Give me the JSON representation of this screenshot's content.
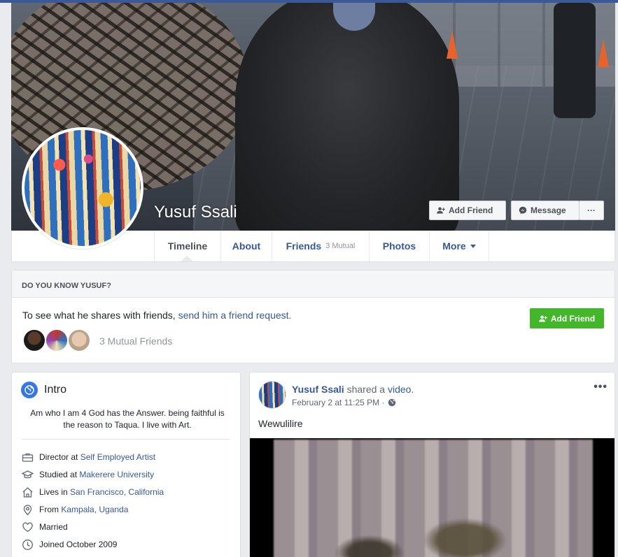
{
  "profile": {
    "name": "Yusuf Ssali",
    "add_friend_label": "Add Friend",
    "message_label": "Message",
    "more_dots": "···"
  },
  "nav": {
    "tabs": [
      {
        "label": "Timeline",
        "active": true
      },
      {
        "label": "About"
      },
      {
        "label": "Friends",
        "sub": "3 Mutual"
      },
      {
        "label": "Photos"
      },
      {
        "label": "More"
      }
    ]
  },
  "know": {
    "heading": "DO YOU KNOW YUSUF?",
    "text_prefix": "To see what he shares with friends, ",
    "link": "send him a friend request.",
    "button_label": "Add Friend",
    "mutual_text": "3 Mutual Friends"
  },
  "intro": {
    "title": "Intro",
    "bio": "Am who I am 4 God has the Answer. being faithful is the reason to Taqua. I live with Art.",
    "items": [
      {
        "icon": "briefcase-icon",
        "prefix": "Director at ",
        "link": "Self Employed Artist"
      },
      {
        "icon": "graduation-cap-icon",
        "prefix": "Studied at ",
        "link": "Makerere University"
      },
      {
        "icon": "home-icon",
        "prefix": "Lives in ",
        "link": "San Francisco, California"
      },
      {
        "icon": "location-pin-icon",
        "prefix": "From ",
        "link": "Kampala, Uganda"
      },
      {
        "icon": "heart-icon",
        "prefix": "Married",
        "link": ""
      },
      {
        "icon": "clock-icon",
        "prefix": "Joined October 2009",
        "link": ""
      }
    ]
  },
  "post": {
    "author": "Yusuf Ssali",
    "action": " shared a ",
    "object": "video",
    "period": ".",
    "time": "February 2 at 11:25 PM ·",
    "text": "Wewulilire",
    "menu": "•••"
  },
  "colors": {
    "brand_blue": "#3b5998",
    "link_blue": "#365899",
    "green": "#42b72a"
  }
}
